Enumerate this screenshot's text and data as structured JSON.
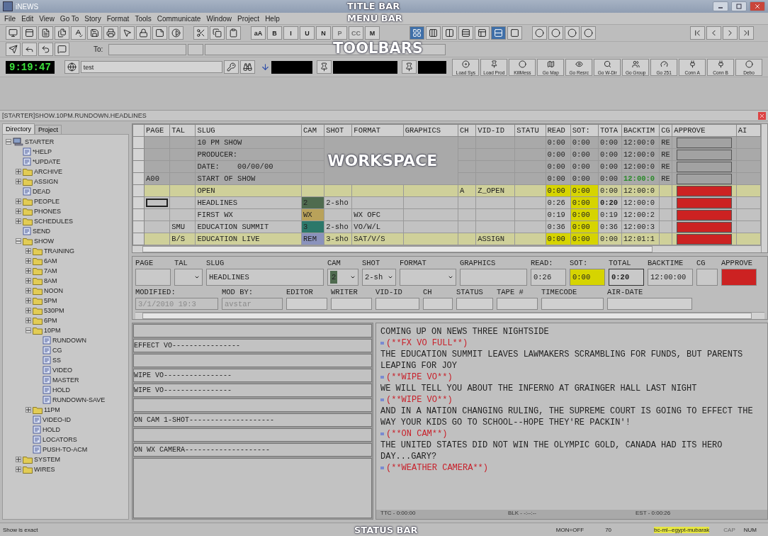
{
  "window": {
    "title": "iNEWS"
  },
  "annotations": [
    {
      "label": "TITLE BAR"
    },
    {
      "label": "MENU BAR"
    },
    {
      "label": "TOOLBARS"
    },
    {
      "label": "WORKSPACE"
    },
    {
      "label": "STATUS BAR"
    }
  ],
  "menu": [
    "File",
    "Edit",
    "View",
    "Go To",
    "Story",
    "Format",
    "Tools",
    "Communicate",
    "Window",
    "Project",
    "Help"
  ],
  "format_buttons": [
    {
      "label": "aA",
      "disabled": false
    },
    {
      "label": "B",
      "disabled": false
    },
    {
      "label": "I",
      "disabled": false
    },
    {
      "label": "U",
      "disabled": false
    },
    {
      "label": "N",
      "disabled": false
    },
    {
      "label": "P",
      "disabled": true
    },
    {
      "label": "CC",
      "disabled": true
    },
    {
      "label": "M",
      "disabled": false
    }
  ],
  "view_buttons": [
    {
      "selected": true
    },
    {
      "selected": false
    },
    {
      "selected": false
    },
    {
      "selected": false
    },
    {
      "selected": false
    },
    {
      "selected": true
    },
    {
      "selected": false
    }
  ],
  "message_bar": {
    "to_label": "To:"
  },
  "clock": "9:19:47",
  "search_field": {
    "value": "test"
  },
  "quick_buttons": [
    {
      "label": "Load Sys"
    },
    {
      "label": "Load Prod"
    },
    {
      "label": "KillMess"
    },
    {
      "label": "Go Map"
    },
    {
      "label": "Go Resrc"
    },
    {
      "label": "Go W-Dir"
    },
    {
      "label": "Go Group"
    },
    {
      "label": "Go 251"
    },
    {
      "label": "Conn A"
    },
    {
      "label": "Conn B"
    },
    {
      "label": "Debo"
    }
  ],
  "path": "[STARTER]SHOW.10PM.RUNDOWN.HEADLINES",
  "tabs": [
    {
      "label": "Directory",
      "selected": true
    },
    {
      "label": "Project",
      "selected": false
    }
  ],
  "tree": {
    "label": "STARTER",
    "kind": "server",
    "expanded": true,
    "children": [
      {
        "label": "*HELP",
        "kind": "story"
      },
      {
        "label": "*UPDATE",
        "kind": "story"
      },
      {
        "label": "ARCHIVE",
        "kind": "folder",
        "expanded": false
      },
      {
        "label": "ASSIGN",
        "kind": "folder",
        "expanded": false
      },
      {
        "label": "DEAD",
        "kind": "story"
      },
      {
        "label": "PEOPLE",
        "kind": "folder",
        "expanded": false
      },
      {
        "label": "PHONES",
        "kind": "folder",
        "expanded": false
      },
      {
        "label": "SCHEDULES",
        "kind": "folder",
        "expanded": false
      },
      {
        "label": "SEND",
        "kind": "story"
      },
      {
        "label": "SHOW",
        "kind": "folder",
        "expanded": true,
        "children": [
          {
            "label": "TRAINING",
            "kind": "folder",
            "expanded": false
          },
          {
            "label": "6AM",
            "kind": "folder",
            "expanded": false
          },
          {
            "label": "7AM",
            "kind": "folder",
            "expanded": false
          },
          {
            "label": "8AM",
            "kind": "folder",
            "expanded": false
          },
          {
            "label": "NOON",
            "kind": "folder",
            "expanded": false
          },
          {
            "label": "5PM",
            "kind": "folder",
            "expanded": false
          },
          {
            "label": "530PM",
            "kind": "folder",
            "expanded": false
          },
          {
            "label": "6PM",
            "kind": "folder",
            "expanded": false
          },
          {
            "label": "10PM",
            "kind": "folder",
            "expanded": true,
            "children": [
              {
                "label": "RUNDOWN",
                "kind": "story"
              },
              {
                "label": "CG",
                "kind": "story"
              },
              {
                "label": "SS",
                "kind": "story"
              },
              {
                "label": "VIDEO",
                "kind": "story"
              },
              {
                "label": "MASTER",
                "kind": "story"
              },
              {
                "label": "HOLD",
                "kind": "story"
              },
              {
                "label": "RUNDOWN-SAVE",
                "kind": "story"
              }
            ]
          },
          {
            "label": "11PM",
            "kind": "folder",
            "expanded": false
          },
          {
            "label": "VIDEO-ID",
            "kind": "story"
          },
          {
            "label": "HOLD",
            "kind": "story"
          },
          {
            "label": "LOCATORS",
            "kind": "story"
          },
          {
            "label": "PUSH-TO-ACM",
            "kind": "story"
          }
        ]
      },
      {
        "label": "SYSTEM",
        "kind": "folder",
        "expanded": false
      },
      {
        "label": "WIRES",
        "kind": "folder",
        "expanded": false
      }
    ]
  },
  "table": {
    "columns": [
      "PAGE",
      "TAL",
      "SLUG",
      "CAM",
      "SHOT",
      "FORMAT",
      "GRAPHICS",
      "CH",
      "VID-ID",
      "STATU",
      "READ",
      "SOT:",
      "TOTA",
      "BACKTIM",
      "CG",
      "APPROVE",
      "AI"
    ],
    "rows": [
      {
        "kind": "break",
        "highlighted": false,
        "current": false,
        "read_alert": false,
        "sot_alert": false,
        "timed": false,
        "slug": "10 PM SHOW",
        "read": "0:00",
        "sot": "0:00",
        "total": "0:00",
        "backtime": "12:00:0",
        "cg": "RE",
        "approval": {
          "color": "#a2a2a2"
        }
      },
      {
        "kind": "break",
        "highlighted": false,
        "current": false,
        "read_alert": false,
        "sot_alert": false,
        "timed": false,
        "slug": "PRODUCER:",
        "read": "0:00",
        "sot": "0:00",
        "total": "0:00",
        "backtime": "12:00:0",
        "cg": "RE",
        "approval": {
          "color": "#a2a2a2"
        }
      },
      {
        "kind": "break",
        "highlighted": false,
        "current": false,
        "read_alert": false,
        "sot_alert": false,
        "timed": false,
        "slug": "DATE:    00/00/00",
        "read": "0:00",
        "sot": "0:00",
        "total": "0:00",
        "backtime": "12:00:0",
        "cg": "RE",
        "approval": {
          "color": "#a2a2a2"
        }
      },
      {
        "kind": "break",
        "highlighted": false,
        "current": false,
        "read_alert": false,
        "sot_alert": false,
        "timed": true,
        "page": "A00",
        "slug": "START OF SHOW",
        "read": "0:00",
        "sot": "0:00",
        "total": "0:00",
        "backtime": "12:00:0",
        "cg": "RE",
        "approval": {
          "color": "#a2a2a2"
        }
      },
      {
        "kind": "story",
        "highlighted": true,
        "current": false,
        "read_alert": true,
        "sot_alert": true,
        "timed": false,
        "slug": "OPEN",
        "ch": "A",
        "vid_id": "Z_OPEN",
        "read": "0:00",
        "sot": "0:00",
        "total": "0:00",
        "backtime": "12:00:0",
        "approval": {
          "color": "#cc2222"
        }
      },
      {
        "kind": "story",
        "highlighted": false,
        "current": true,
        "read_alert": false,
        "sot_alert": true,
        "timed": false,
        "slug": "HEADLINES",
        "cam": {
          "label": "2",
          "color": "#4f6b4f"
        },
        "shot": "2-sho",
        "read": "0:26",
        "sot": "0:00",
        "total": "0:20",
        "backtime": "12:00:0",
        "approval": {
          "color": "#cc2222"
        }
      },
      {
        "kind": "story",
        "highlighted": false,
        "current": false,
        "read_alert": false,
        "sot_alert": true,
        "timed": false,
        "slug": "FIRST WX",
        "cam": {
          "label": "WX",
          "color": "#b9a25a"
        },
        "format": "WX OFC",
        "read": "0:19",
        "sot": "0:00",
        "total": "0:19",
        "backtime": "12:00:2",
        "approval": {
          "color": "#cc2222"
        }
      },
      {
        "kind": "story",
        "highlighted": false,
        "current": false,
        "read_alert": false,
        "sot_alert": true,
        "timed": false,
        "tal": "SMU",
        "slug": "EDUCATION SUMMIT",
        "cam": {
          "label": "3",
          "color": "#2c786a"
        },
        "shot": "2-sho",
        "format": "VO/W/L",
        "read": "0:36",
        "sot": "0:00",
        "total": "0:36",
        "backtime": "12:00:3",
        "approval": {
          "color": "#cc2222"
        }
      },
      {
        "kind": "story",
        "highlighted": true,
        "current": false,
        "read_alert": true,
        "sot_alert": true,
        "timed": false,
        "tal": "B/S",
        "slug": "EDUCATION LIVE",
        "cam": {
          "label": "REM",
          "color": "#8a92bc"
        },
        "shot": "3-sho",
        "format": "SAT/V/S",
        "vid_id": "ASSIGN",
        "read": "0:00",
        "sot": "0:00",
        "total": "0:00",
        "backtime": "12:01:1",
        "approval": {
          "color": "#cc2222"
        }
      }
    ]
  },
  "story_form": {
    "row1": [
      {
        "label": "PAGE",
        "kind": "text",
        "alert": false,
        "emphasized": false
      },
      {
        "label": "TAL",
        "kind": "select",
        "alert": false,
        "emphasized": false
      },
      {
        "label": "SLUG",
        "kind": "text",
        "value": "HEADLINES",
        "alert": false,
        "emphasized": false
      },
      {
        "label": "CAM",
        "kind": "select",
        "value": "2",
        "color": "#4f6b4f",
        "alert": false,
        "emphasized": false
      },
      {
        "label": "SHOT",
        "kind": "select",
        "value": "2-sh",
        "alert": false,
        "emphasized": false
      },
      {
        "label": "FORMAT",
        "kind": "select",
        "alert": false,
        "emphasized": false
      },
      {
        "label": "GRAPHICS",
        "kind": "text",
        "alert": false,
        "emphasized": false
      },
      {
        "label": "READ:",
        "kind": "text",
        "value": "0:26",
        "alert": false,
        "emphasized": false
      },
      {
        "label": "SOT:",
        "kind": "text",
        "value": "0:00",
        "alert": true,
        "emphasized": false
      },
      {
        "label": "TOTAL",
        "kind": "text",
        "value": "0:20",
        "alert": false,
        "emphasized": true
      },
      {
        "label": "BACKTIME",
        "kind": "text",
        "value": "12:00:00",
        "alert": false,
        "emphasized": false
      },
      {
        "label": "CG",
        "kind": "text",
        "alert": false,
        "emphasized": false
      },
      {
        "label": "APPROVE",
        "kind": "swatch",
        "color": "#cc2222",
        "alert": false,
        "emphasized": false
      }
    ],
    "row2": [
      {
        "label": "MODIFIED:",
        "value": "3/1/2010 19:3",
        "disabled": true
      },
      {
        "label": "MOD BY:",
        "value": "avstar",
        "disabled": true
      },
      {
        "label": "EDITOR",
        "disabled": false
      },
      {
        "label": "WRITER",
        "disabled": false
      },
      {
        "label": "VID-ID",
        "disabled": false
      },
      {
        "label": "CH",
        "disabled": false
      },
      {
        "label": "STATUS",
        "disabled": false
      },
      {
        "label": "TAPE #",
        "disabled": false
      },
      {
        "label": "TIMECODE",
        "disabled": false
      },
      {
        "label": "AIR-DATE",
        "disabled": false
      }
    ]
  },
  "cues": [
    {
      "kind": "blank"
    },
    {
      "kind": "cue",
      "text": "EFFECT VO----------------"
    },
    {
      "kind": "blank"
    },
    {
      "kind": "cue",
      "text": "WIPE VO----------------"
    },
    {
      "kind": "cue",
      "text": "WIPE VO----------------"
    },
    {
      "kind": "blank"
    },
    {
      "kind": "cue",
      "text": "ON CAM 1-SHOT--------------------"
    },
    {
      "kind": "blank"
    },
    {
      "kind": "cue",
      "text": "ON WX CAMERA--------------------"
    },
    {
      "kind": "blank"
    }
  ],
  "script": [
    {
      "kind": "text",
      "text": "COMING UP ON NEWS THREE NIGHTSIDE"
    },
    {
      "kind": "cue",
      "text": "(**FX VO FULL**)"
    },
    {
      "kind": "text",
      "text": "THE EDUCATION SUMMIT LEAVES LAWMAKERS SCRAMBLING FOR FUNDS, BUT PARENTS LEAPING FOR JOY"
    },
    {
      "kind": "cue",
      "text": "(**WIPE VO**)"
    },
    {
      "kind": "text",
      "text": "WE WILL TELL YOU ABOUT THE INFERNO AT GRAINGER HALL LAST NIGHT"
    },
    {
      "kind": "cue",
      "text": "(**WIPE VO**)"
    },
    {
      "kind": "text",
      "text": "AND IN A NATION CHANGING RULING, THE SUPREME COURT IS GOING TO EFFECT THE WAY YOUR KIDS GO TO SCHOOL--HOPE THEY'RE PACKIN'!"
    },
    {
      "kind": "cue",
      "text": "(**ON CAM**)"
    },
    {
      "kind": "text",
      "text": "THE UNITED STATES DID NOT WIN THE OLYMPIC GOLD, CANADA HAD ITS HERO DAY...GARY?"
    },
    {
      "kind": "cue",
      "text": "(**WEATHER CAMERA**)"
    }
  ],
  "script_footer": [
    "TTC - 0:00:00",
    "BLK - -:--:--",
    "EST - 0:00:26"
  ],
  "status_bar": {
    "message": "Show is exact",
    "monitor": "MON=OFF",
    "count": "70",
    "queue": "bc-ml--egypt-mubarak",
    "indicators": [
      {
        "label": "CAP",
        "on": false
      },
      {
        "label": "NUM",
        "on": true
      }
    ]
  }
}
